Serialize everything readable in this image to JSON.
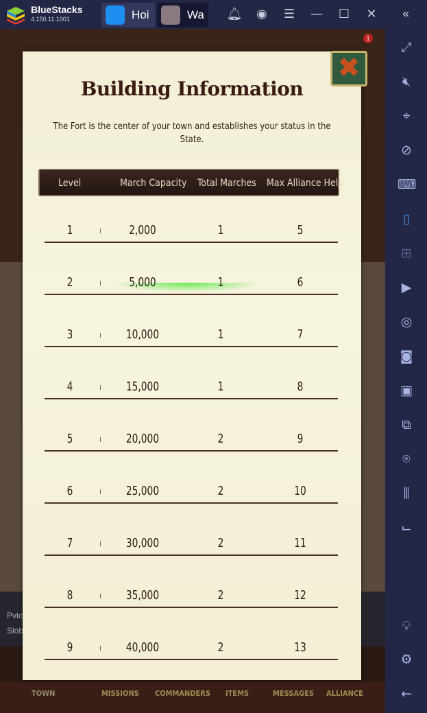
{
  "titlebar": {
    "brand": "BlueStacks",
    "version": "4.150.11.1001",
    "tabs": [
      {
        "label": "Hoi"
      },
      {
        "label": "Wa"
      }
    ]
  },
  "game": {
    "dialog": {
      "title": "Building Information",
      "description": "The Fort is the center of your town and establishes your status in the State.",
      "columns": [
        "Level",
        "March Capacity",
        "Total Marches",
        "Max Alliance Help"
      ],
      "rows": [
        {
          "level": "1",
          "capacity": "2,000",
          "marches": "1",
          "help": "5"
        },
        {
          "level": "2",
          "capacity": "5,000",
          "marches": "1",
          "help": "6",
          "highlighted": true
        },
        {
          "level": "3",
          "capacity": "10,000",
          "marches": "1",
          "help": "7"
        },
        {
          "level": "4",
          "capacity": "15,000",
          "marches": "1",
          "help": "8"
        },
        {
          "level": "5",
          "capacity": "20,000",
          "marches": "2",
          "help": "9"
        },
        {
          "level": "6",
          "capacity": "25,000",
          "marches": "2",
          "help": "10"
        },
        {
          "level": "7",
          "capacity": "30,000",
          "marches": "2",
          "help": "11"
        },
        {
          "level": "8",
          "capacity": "35,000",
          "marches": "2",
          "help": "12"
        },
        {
          "level": "9",
          "capacity": "40,000",
          "marches": "2",
          "help": "13"
        }
      ]
    },
    "notification_count": "1",
    "chat": [
      "Pvtc",
      "Slob"
    ],
    "nav": [
      "TOWN",
      "MISSIONS",
      "COMMANDERS",
      "ITEMS",
      "MESSAGES",
      "ALLIANCE"
    ]
  },
  "colors": {
    "highlight": "#50e63c",
    "chrome": "#232745"
  }
}
